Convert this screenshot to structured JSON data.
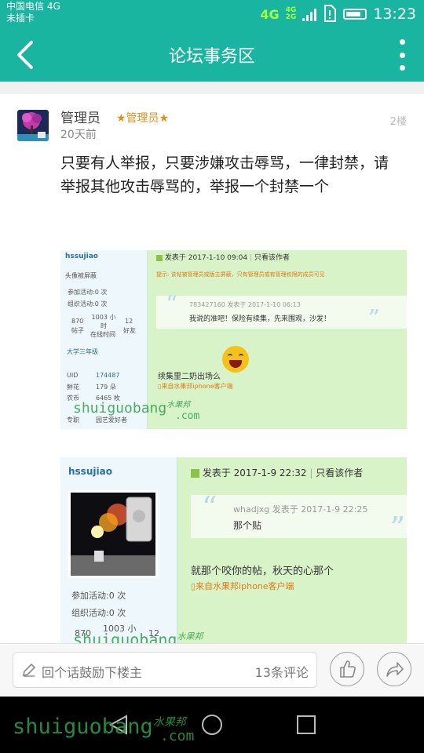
{
  "status_bar": {
    "carrier": "中国电信 4G",
    "sim_status": "未插卡",
    "network_4g": "4G",
    "network_small_top": "4G",
    "network_small_bottom": "2G",
    "time": "13:23"
  },
  "app_bar": {
    "title": "论坛事务区"
  },
  "post": {
    "author": "管理员",
    "role_badge": "★管理员★",
    "time_ago": "20天前",
    "floor": "2楼",
    "text": "只要有人举报，只要涉嫌攻击辱骂，一律封禁，请举报其他攻击辱骂的，举报一个封禁一个"
  },
  "screenshot1": {
    "username": "hssujiao",
    "avatar_blocked": "头像被屏蔽",
    "activity1": "参加活动:0 次",
    "activity2": "组织活动:0 次",
    "posts_num": "870",
    "posts_label": "帖子",
    "online_num": "1003 小时",
    "online_label": "在线时间",
    "friends_num": "12",
    "friends_label": "好友",
    "grade": "大学三年级",
    "uid_label": "UID",
    "uid": "174487",
    "flower_label": "鲜花",
    "flower": "179 朵",
    "coin_label": "农币",
    "coin": "6465 枚",
    "specialty_label": "专职",
    "specialty": "园艺爱好者",
    "post_time": "发表于 2017-1-10 09:04",
    "author_only": "只看该作者",
    "notice": "提示: 该帖被管理员或版主屏蔽，只有管理员或有管理权限的成员可见",
    "quote_meta": "783427160 发表于 2017-1-10 06:13",
    "quote_text": "我说的准吧！保险有续集，先来围观，沙发！",
    "reply_text": "续集里二奶出场么",
    "client": "来自水果邦iphone客户端",
    "watermark": "shuiguobang",
    "watermark_cn": "水果邦",
    "watermark_com": ".com"
  },
  "screenshot2": {
    "username": "hssujiao",
    "activity1": "参加活动:0 次",
    "activity2": "组织活动:0 次",
    "posts_num": "870",
    "online_num": "1003 小",
    "friends_num": "12",
    "post_time": "发表于 2017-1-9 22:32",
    "author_only": "只看该作者",
    "quote_meta": "whadjxg 发表于 2017-1-9 22:25",
    "quote_text": "那个贴",
    "reply_text": "就那个咬你的帖，秋天的心那个",
    "client": "来自水果邦iphone客户端",
    "watermark": "shuiguobang",
    "watermark_cn": "水果邦"
  },
  "footer": {
    "reply_placeholder": "回个话鼓励下楼主",
    "comment_count": "13条评论"
  },
  "nav_watermark": {
    "text": "shuiguobang",
    "cn": "水果邦",
    "com": ".com"
  },
  "colors": {
    "accent": "#1ab5a0",
    "badge": "#e0901c",
    "watermark": "#2fa04a"
  }
}
